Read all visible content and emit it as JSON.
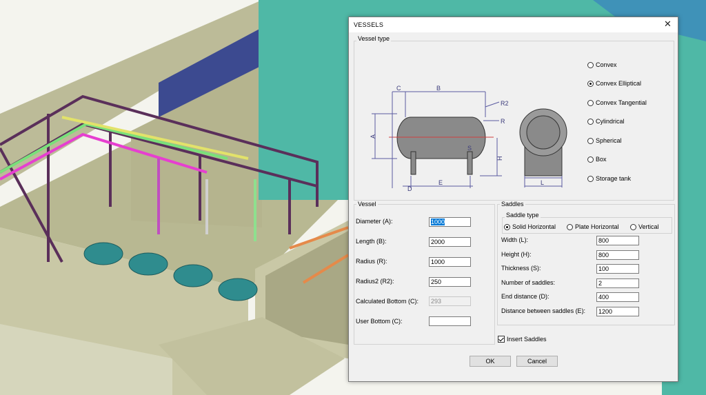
{
  "dialog": {
    "title": "VESSELS",
    "vessel_type_label": "Vessel type",
    "vessel_types": [
      {
        "label": "Convex",
        "selected": false
      },
      {
        "label": "Convex Elliptical",
        "selected": true
      },
      {
        "label": "Convex Tangential",
        "selected": false
      },
      {
        "label": "Cylindrical",
        "selected": false
      },
      {
        "label": "Spherical",
        "selected": false
      },
      {
        "label": "Box",
        "selected": false
      },
      {
        "label": "Storage tank",
        "selected": false
      }
    ],
    "diagram_labels": {
      "c": "C",
      "b": "B",
      "r2": "R2",
      "r": "R",
      "a": "A",
      "s": "S",
      "h": "H",
      "d": "D",
      "e": "E",
      "l": "L"
    },
    "vessel": {
      "label": "Vessel",
      "fields": [
        {
          "label": "Diameter (A):",
          "value": "1000",
          "state": "selected"
        },
        {
          "label": "Length (B):",
          "value": "2000",
          "state": "normal"
        },
        {
          "label": "Radius (R):",
          "value": "1000",
          "state": "normal"
        },
        {
          "label": "Radius2 (R2):",
          "value": "250",
          "state": "normal"
        },
        {
          "label": "Calculated Bottom (C):",
          "value": "293",
          "state": "disabled"
        },
        {
          "label": "User Bottom (C):",
          "value": "",
          "state": "normal"
        }
      ]
    },
    "saddles": {
      "label": "Saddles",
      "saddle_type_label": "Saddle type",
      "saddle_types": [
        {
          "label": "Solid Horizontal",
          "selected": true
        },
        {
          "label": "Plate Horizontal",
          "selected": false
        },
        {
          "label": "Vertical",
          "selected": false
        }
      ],
      "fields": [
        {
          "label": "Width (L):",
          "value": "800"
        },
        {
          "label": "Height (H):",
          "value": "800"
        },
        {
          "label": "Thickness (S):",
          "value": "100"
        },
        {
          "label": "Number of saddles:",
          "value": "2"
        },
        {
          "label": "End distance (D):",
          "value": "400"
        },
        {
          "label": "Distance between saddles (E):",
          "value": "1200"
        }
      ]
    },
    "insert_saddles": {
      "label": "Insert Saddles",
      "checked": true
    },
    "ok_label": "OK",
    "cancel_label": "Cancel"
  },
  "colors": {
    "accent": "#0078d7",
    "tank": "#4fb8a6",
    "dimension_line": "#5a5aa0"
  }
}
